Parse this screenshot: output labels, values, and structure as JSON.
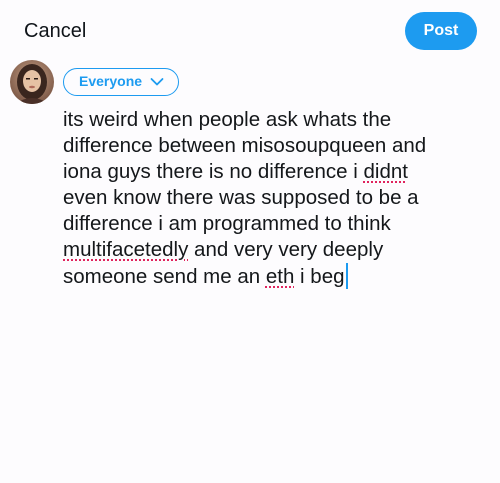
{
  "header": {
    "cancel_label": "Cancel",
    "post_label": "Post"
  },
  "audience": {
    "label": "Everyone"
  },
  "compose": {
    "lines": [
      [
        "its weird when people ask whats the"
      ],
      [
        "difference between misosoupqueen and"
      ],
      [
        "iona guys there is no difference i ",
        "didnt"
      ],
      [
        "even know there was supposed to be a"
      ],
      [
        "difference i am programmed to think"
      ],
      [
        "multifacetedly",
        " and very very deeply"
      ],
      [
        "someone send me an ",
        "eth",
        " i beg"
      ]
    ]
  },
  "colors": {
    "accent": "#1d9bf0",
    "text": "#14171a",
    "spellcheck": "#e0245e"
  }
}
